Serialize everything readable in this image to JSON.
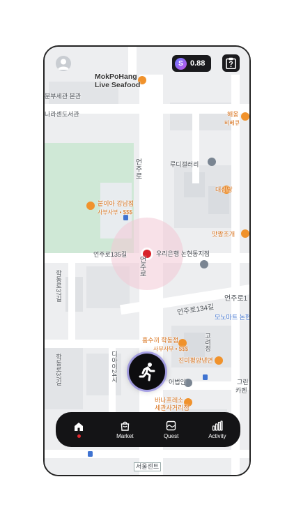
{
  "header": {
    "coin_balance": "0.88",
    "coin_symbol": "S"
  },
  "colors": {
    "accent_dot": "#e0282e",
    "tabbar_bg": "#141416",
    "poi_orange": "#d8711a",
    "transit_blue": "#3f73d1"
  },
  "icons": {
    "avatar": "user-avatar-icon",
    "coin": "coin-icon",
    "clipboard": "clipboard-question-icon",
    "run": "running-person-icon",
    "home": "home-icon",
    "market": "shopping-bag-icon",
    "quest": "quest-box-icon",
    "activity": "bar-chart-icon"
  },
  "map": {
    "labels": {
      "mokpohang": "MokPoHang",
      "live_seafood": "Live Seafood",
      "branch_office": "분부세관 본관",
      "library": "나라센도서관",
      "haeong": "해옹",
      "bibekyu": "비베큐",
      "rudy_gallery": "루디갤러리",
      "daesam": "대삼당",
      "road_eonju_v": "언주로",
      "bulie": "붙이아 강남점",
      "bulie_sub": "사부사부 • $$$",
      "matjjang": "맛짱조개",
      "eonju135": "언주로135길",
      "woori": "우리은행 논현동지점",
      "road_eonju_v2": "언주로",
      "eonju134": "언주로134길",
      "eonju_right": "언주로1",
      "monomart": "모노마트 논현",
      "hakdong37a": "학동로37길",
      "hongsukki": "홈수끼 학동점",
      "hongsukki_sub": "사부사부 • $$$",
      "jinmi": "진미평양냉면",
      "hakdong37b": "학동로37길",
      "banafresso": "바나프레소",
      "sewan_branch": "세관사거리점",
      "corp": "어법인",
      "green": "그린",
      "kaben": "카벤",
      "seoulforest": "서울센트",
      "dia24": "디아이24시",
      "ddp": "학동",
      "bunsik": "고려정",
      "seoulmap": "서울센트"
    }
  },
  "tabbar": {
    "tabs": [
      {
        "label": "",
        "name": "Home"
      },
      {
        "label": "Market"
      },
      {
        "label": "Quest"
      },
      {
        "label": "Activity"
      }
    ]
  }
}
